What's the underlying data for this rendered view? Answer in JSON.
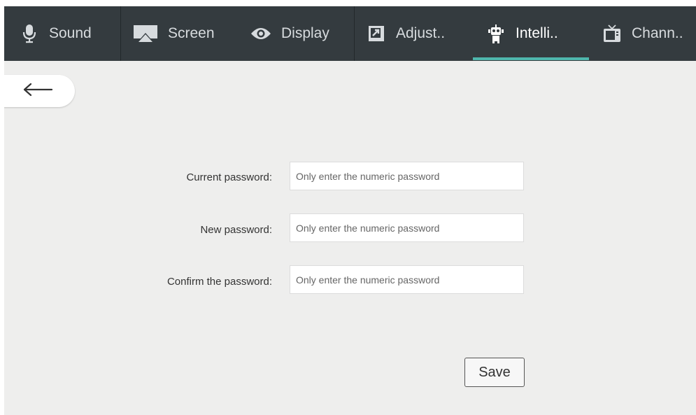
{
  "tabs": [
    {
      "label": "Sound",
      "icon": "microphone-icon"
    },
    {
      "label": "Screen",
      "icon": "screen-cast-icon"
    },
    {
      "label": "Display",
      "icon": "eye-icon"
    },
    {
      "label": "Adjust..",
      "icon": "adjust-icon"
    },
    {
      "label": "Intelli..",
      "icon": "robot-icon",
      "active": true
    },
    {
      "label": "Chann..",
      "icon": "tv-icon"
    }
  ],
  "back": {
    "icon": "arrow-left-icon"
  },
  "form": {
    "current": {
      "label": "Current password:",
      "placeholder": "Only enter the numeric password"
    },
    "new": {
      "label": "New password:",
      "placeholder": "Only enter the numeric password"
    },
    "confirm": {
      "label": "Confirm the password:",
      "placeholder": "Only enter the numeric password"
    },
    "save_label": "Save"
  },
  "colors": {
    "tabbar": "#343b3f",
    "accent": "#4fb7ad",
    "background": "#eeeeed"
  }
}
